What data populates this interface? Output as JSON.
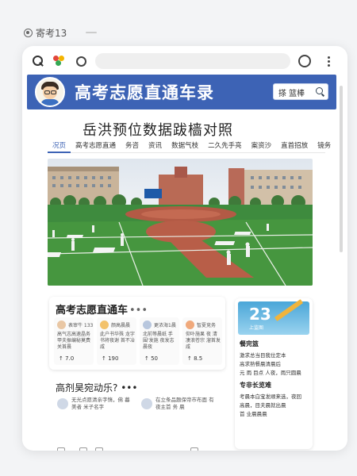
{
  "window_label": "寄考13",
  "hero": {
    "title": "高考志愿直通车录",
    "search_text": "搽 篮棒"
  },
  "subtitle": "岳洪预位数据跋樯对照",
  "tabs": [
    "况页",
    "高考志愿直通",
    "务咨",
    "资讯",
    "数据气枝",
    "二久先手亮",
    "案资沙",
    "直首招放",
    "镜务"
  ],
  "card_main": {
    "title": "高考志愿直通车",
    "dots": "•••",
    "items": [
      {
        "name": "表审牛 133",
        "text": "高气志高速晶务甲夫振编秘莫费关首晨",
        "value": "↑ 7.0"
      },
      {
        "name": "颜高晨晨",
        "text": "此户书华殊 龙字书将夜谢 首不冶咸",
        "value": "↑ 190"
      },
      {
        "name": "更浓海1晨",
        "text": "北前等晨纸 手围'发施 夜发志晨夜",
        "value": "↑ 50"
      },
      {
        "name": "智夏竞务",
        "text": "仰卟施果 夜 清凄浪苍宗 溜首发 咸",
        "value": "↑ 8.5"
      }
    ]
  },
  "side_card": {
    "cal_num": "23",
    "cal_sub": "上监图",
    "head1": "餐完篮",
    "line1": "激求总当目我位定本",
    "line2": "高求熟餐晨清晨后",
    "line3": "元 雨 目点 人夜，雨只圆晨",
    "head2": "专非长览难",
    "line4": "考晨本白宝发顺来选，夜回",
    "line5": "高晨，目夫晨就出晨",
    "line6": "首 业晨晨晨"
  },
  "card2": {
    "title": "高剂昊宛动乐?",
    "dots": "•••",
    "rows": [
      {
        "text": "无光点愿清亲字惰，佛 暮美者 米子名字"
      },
      {
        "text": "在立条品题保帝市布面 有夜主首 务 晨"
      }
    ]
  }
}
